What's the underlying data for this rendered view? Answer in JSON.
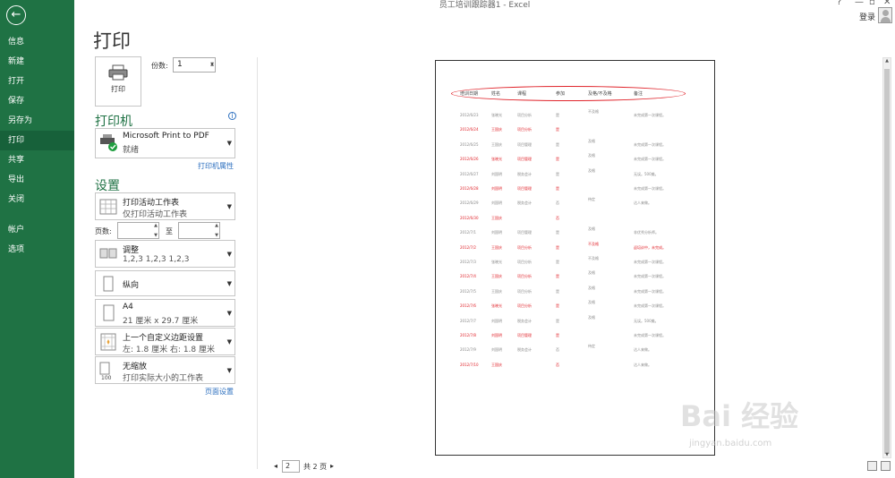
{
  "window": {
    "title": "员工培训跟踪器1 - Excel",
    "help": "?",
    "minimize": "—",
    "restore": "▫",
    "close": "✕",
    "signin": "登录"
  },
  "sidebar": {
    "back": "←",
    "items": [
      {
        "label": "信息"
      },
      {
        "label": "新建"
      },
      {
        "label": "打开"
      },
      {
        "label": "保存"
      },
      {
        "label": "另存为"
      },
      {
        "label": "打印",
        "active": true
      },
      {
        "label": "共享"
      },
      {
        "label": "导出"
      },
      {
        "label": "关闭"
      },
      {
        "label": "帐户"
      },
      {
        "label": "选项"
      }
    ]
  },
  "print": {
    "heading": "打印",
    "print_button": "打印",
    "copies_label": "份数:",
    "copies_value": "1",
    "printer_section": "打印机",
    "info": "i",
    "printer_name": "Microsoft Print to PDF",
    "printer_status": "就绪",
    "printer_properties": "打印机属性",
    "settings_section": "设置",
    "scope_title": "打印活动工作表",
    "scope_sub": "仅打印活动工作表",
    "pages_label": "页数:",
    "pages_to": "至",
    "collate_title": "调整",
    "collate_sub": "1,2,3    1,2,3    1,2,3",
    "orientation": "纵向",
    "paper_title": "A4",
    "paper_sub": "21 厘米 x 29.7 厘米",
    "margins_title": "上一个自定义边距设置",
    "margins_sub": "左: 1.8 厘米    右: 1.8 厘米",
    "scaling_title": "无缩放",
    "scaling_sub": "打印实际大小的工作表",
    "page_setup": "页面设置"
  },
  "preview": {
    "headers": [
      "培训日期",
      "姓名",
      "课程",
      "参加",
      "及格/不及格",
      "备注"
    ],
    "rows": [
      {
        "date": "2012/6/23",
        "name": "张晓光",
        "course": "项目分析",
        "att": "是",
        "pass": "不及格",
        "note": "未完成第一次课程。",
        "red": false
      },
      {
        "date": "2012/6/24",
        "name": "王国庆",
        "course": "项目分析",
        "att": "是",
        "pass": "",
        "note": "",
        "red": true
      },
      {
        "date": "2012/6/25",
        "name": "王国庆",
        "course": "项目管理",
        "att": "是",
        "pass": "及格",
        "note": "未完成第一次课程。",
        "red": false
      },
      {
        "date": "2012/6/26",
        "name": "张晓光",
        "course": "项目管理",
        "att": "是",
        "pass": "及格",
        "note": "未完成第一次课程。",
        "red": true
      },
      {
        "date": "2012/6/27",
        "name": "刘国明",
        "course": "税务会计",
        "att": "是",
        "pass": "及格",
        "note": "无误。500美。",
        "red": false
      },
      {
        "date": "2012/6/28",
        "name": "刘国明",
        "course": "项目管理",
        "att": "是",
        "pass": "",
        "note": "未完成第一次课程。",
        "red": true
      },
      {
        "date": "2012/6/29",
        "name": "刘国明",
        "course": "税务会计",
        "att": "否",
        "pass": "待定",
        "note": "达人来做。",
        "red": false
      },
      {
        "date": "2012/6/30",
        "name": "王国庆",
        "course": "",
        "att": "否",
        "pass": "",
        "note": "",
        "red": true
      },
      {
        "date": "2012/7/1",
        "name": "刘国明",
        "course": "项目管理",
        "att": "是",
        "pass": "及格",
        "note": "非优秀分析师。",
        "red": false
      },
      {
        "date": "2012/7/2",
        "name": "王国庆",
        "course": "项目分析",
        "att": "是",
        "pass": "不及格",
        "note": "返培训中，未完成。",
        "red": true
      },
      {
        "date": "2012/7/3",
        "name": "张晓光",
        "course": "项目分析",
        "att": "是",
        "pass": "不及格",
        "note": "未完成第一次课程。",
        "red": false
      },
      {
        "date": "2012/7/4",
        "name": "王国庆",
        "course": "项目分析",
        "att": "是",
        "pass": "及格",
        "note": "未完成第一次课程。",
        "red": true
      },
      {
        "date": "2012/7/5",
        "name": "王国庆",
        "course": "项目分析",
        "att": "是",
        "pass": "及格",
        "note": "未完成第一次课程。",
        "red": false
      },
      {
        "date": "2012/7/6",
        "name": "张晓光",
        "course": "项目分析",
        "att": "是",
        "pass": "及格",
        "note": "未完成第一次课程。",
        "red": true
      },
      {
        "date": "2012/7/7",
        "name": "刘国明",
        "course": "税务会计",
        "att": "是",
        "pass": "及格",
        "note": "无误。500美。",
        "red": false
      },
      {
        "date": "2012/7/8",
        "name": "刘国明",
        "course": "项目管理",
        "att": "是",
        "pass": "",
        "note": "未完成第一次课程。",
        "red": true
      },
      {
        "date": "2012/7/9",
        "name": "刘国明",
        "course": "税务会计",
        "att": "否",
        "pass": "待定",
        "note": "达人来做。",
        "red": false
      },
      {
        "date": "2012/7/10",
        "name": "王国庆",
        "course": "",
        "att": "否",
        "pass": "",
        "note": "达人来做。",
        "red": true
      }
    ]
  },
  "pager": {
    "prev": "◂",
    "current": "2",
    "total": "共 2 页",
    "next": "▸"
  },
  "watermark": {
    "brand": "Bai 经验",
    "url": "jingyan.baidu.com"
  },
  "colors": {
    "sidebar": "#1f7244",
    "accent_green": "#1f7244",
    "link_blue": "#2c6fbf",
    "red": "#e0242b"
  }
}
